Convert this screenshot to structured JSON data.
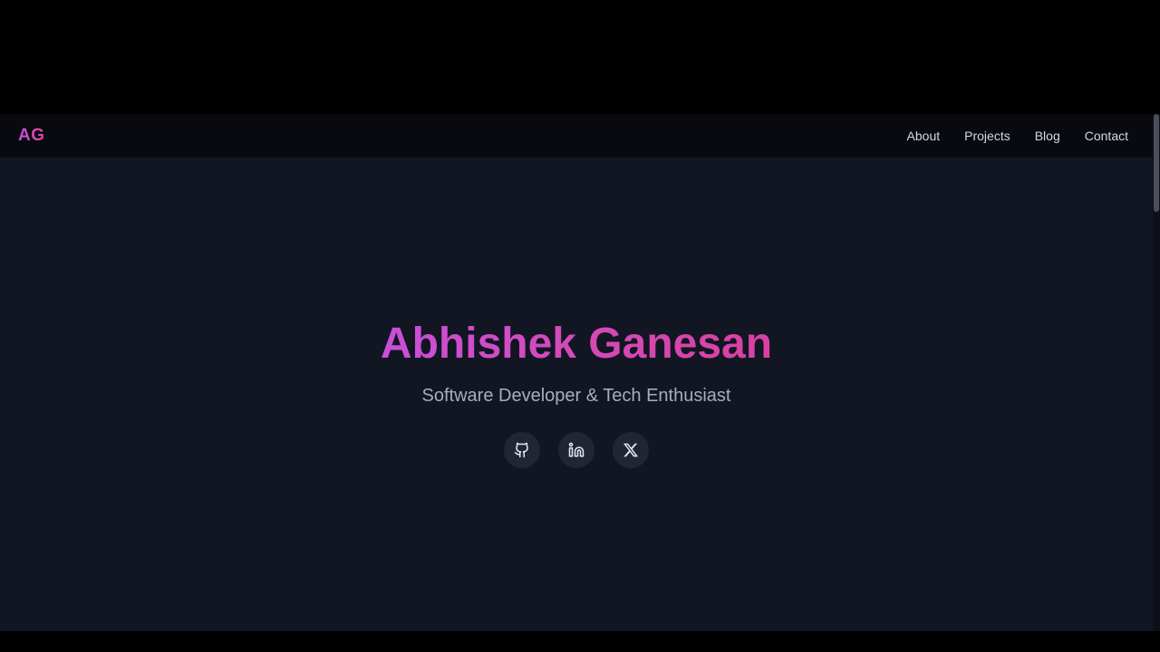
{
  "header": {
    "logo": "AG",
    "nav": [
      "About",
      "Projects",
      "Blog",
      "Contact"
    ]
  },
  "hero": {
    "name": "Abhishek Ganesan",
    "tagline": "Software Developer & Tech Enthusiast"
  },
  "socials": [
    {
      "icon": "github-icon"
    },
    {
      "icon": "linkedin-icon"
    },
    {
      "icon": "x-icon"
    }
  ],
  "colors": {
    "page_bg": "#111622",
    "header_bg": "#080a0f",
    "accent_start": "#c94fd8",
    "accent_end": "#d940a2"
  }
}
